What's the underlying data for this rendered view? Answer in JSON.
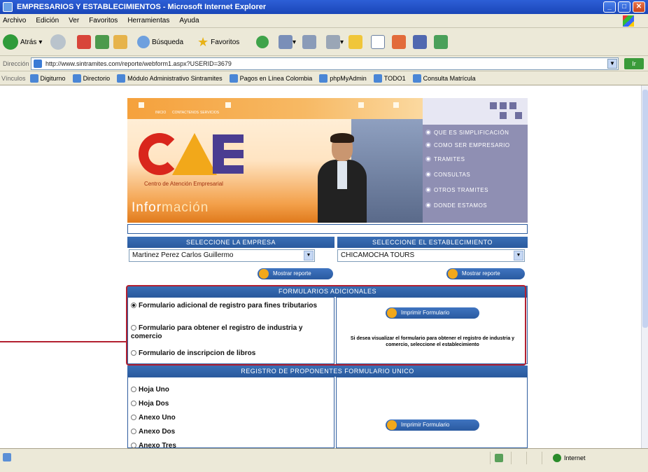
{
  "window": {
    "title": "EMPRESARIOS Y ESTABLECIMIENTOS - Microsoft Internet Explorer"
  },
  "menu": [
    "Archivo",
    "Edición",
    "Ver",
    "Favoritos",
    "Herramientas",
    "Ayuda"
  ],
  "toolbar": {
    "back_label": "Atrás",
    "search_label": "Búsqueda",
    "favorites_label": "Favoritos"
  },
  "address": {
    "label": "Dirección",
    "url": "http://www.sintramites.com/reporte/webform1.aspx?USERID=3679",
    "go_label": "Ir"
  },
  "links": {
    "label": "Vínculos",
    "items": [
      "Digiturno",
      "Directorio",
      "Módulo Administrativo Sintramites",
      "Pagos en Línea Colombia",
      "phpMyAdmin",
      "TODO1",
      "Consulta Matrícula"
    ]
  },
  "site": {
    "logo_caption": "Centro de Atención Empresarial",
    "banner_title_a": "Infor",
    "banner_title_b": "mación",
    "top_nav": [
      "INICIO",
      "CONTACTENOS",
      "SERVICIOS"
    ],
    "side_nav": [
      "QUE ES SIMPLIFICACIÓN",
      "COMO SER EMPRESARIO",
      "TRAMITES",
      "CONSULTAS",
      "OTROS TRAMITES",
      "DONDE ESTAMOS"
    ],
    "company": {
      "header": "SELECCIONE LA EMPRESA",
      "value": "Martinez Perez Carlos Guillermo",
      "report_button": "Mostrar reporte"
    },
    "establishment": {
      "header": "SELECCIONE EL ESTABLECIMIENTO",
      "value": "CHICAMOCHA TOURS",
      "report_button": "Mostrar reporte"
    },
    "additional_forms": {
      "header": "FORMULARIOS ADICIONALES",
      "options": [
        "Formulario adicional de registro para fines tributarios",
        "Formulario para obtener el registro de industria y comercio",
        "Formulario de inscripcion de libros"
      ],
      "selected_index": 0,
      "print_button": "Imprimir Formulario",
      "note": "Si desea visualizar el formulario para obtener el registro de industria y comercio, seleccione el establecimiento"
    },
    "proponents": {
      "header": "REGISTRO DE PROPONENTES FORMULARIO UNICO",
      "options": [
        "Hoja Uno",
        "Hoja Dos",
        "Anexo Uno",
        "Anexo Dos",
        "Anexo Tres"
      ],
      "print_button": "Imprimir Formulario"
    }
  },
  "status": {
    "zone": "Internet"
  },
  "colors": {
    "header_blue": "#2a5a9e",
    "accent_orange": "#f2a81a",
    "highlight_red": "#b32030",
    "side_nav": "#8f8fb3"
  }
}
